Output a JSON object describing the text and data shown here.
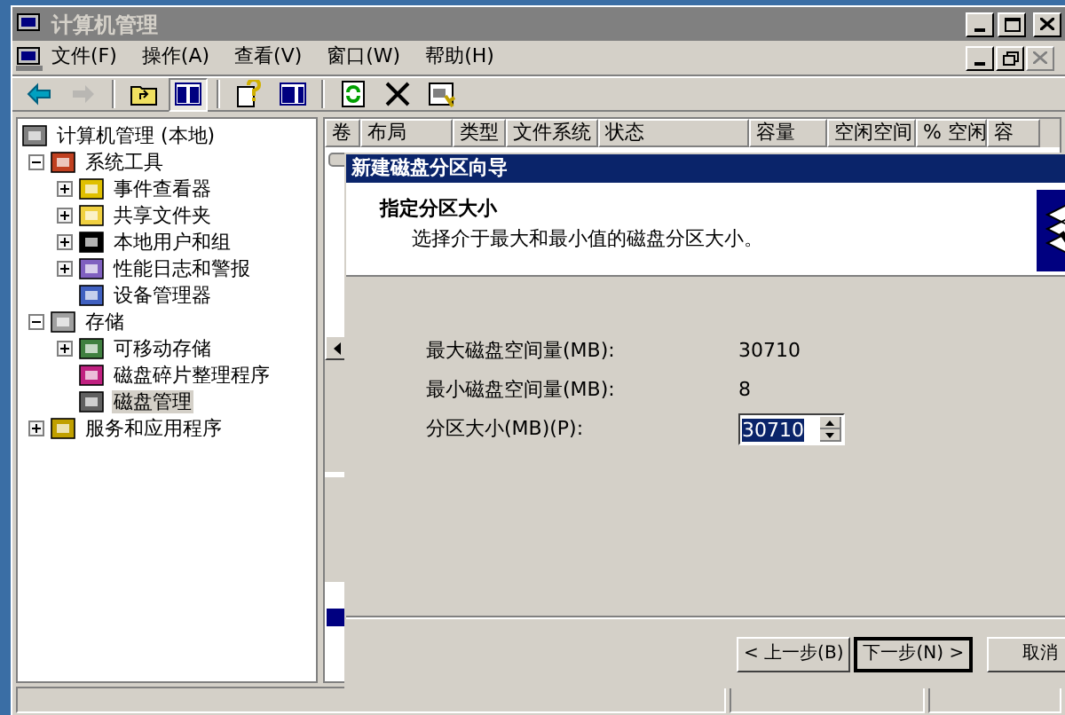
{
  "window": {
    "title": "计算机管理"
  },
  "menu": [
    {
      "label": "文件(F)"
    },
    {
      "label": "操作(A)"
    },
    {
      "label": "查看(V)"
    },
    {
      "label": "窗口(W)"
    },
    {
      "label": "帮助(H)"
    }
  ],
  "toolbar": [
    {
      "kind": "back",
      "disabled": false
    },
    {
      "kind": "forward",
      "disabled": true
    },
    {
      "kind": "sep"
    },
    {
      "kind": "up",
      "disabled": false
    },
    {
      "kind": "tree",
      "disabled": false,
      "selected": true
    },
    {
      "kind": "sep"
    },
    {
      "kind": "help",
      "disabled": false
    },
    {
      "kind": "pane",
      "disabled": false
    },
    {
      "kind": "sep"
    },
    {
      "kind": "refresh",
      "disabled": false
    },
    {
      "kind": "delete",
      "disabled": false
    },
    {
      "kind": "props",
      "disabled": false
    }
  ],
  "tree": [
    {
      "label": "计算机管理 (本地)",
      "selected": false,
      "children": [
        {
          "label": "系统工具",
          "expanded": true,
          "selected": false,
          "children": [
            {
              "label": "事件查看器",
              "expanded": false,
              "selected": false
            },
            {
              "label": "共享文件夹",
              "expanded": false,
              "selected": false
            },
            {
              "label": "本地用户和组",
              "expanded": false,
              "selected": false
            },
            {
              "label": "性能日志和警报",
              "expanded": false,
              "selected": false
            },
            {
              "label": "设备管理器",
              "selected": false
            }
          ]
        },
        {
          "label": "存储",
          "expanded": true,
          "selected": false,
          "children": [
            {
              "label": "可移动存储",
              "expanded": false,
              "selected": false
            },
            {
              "label": "磁盘碎片整理程序",
              "selected": false
            },
            {
              "label": "磁盘管理",
              "selected": true
            }
          ]
        },
        {
          "label": "服务和应用程序",
          "expanded": false,
          "selected": false
        }
      ]
    }
  ],
  "table": {
    "columns": [
      "卷",
      "布局",
      "类型",
      "文件系统",
      "状态",
      "容量",
      "空闲空间",
      "% 空闲",
      "容"
    ]
  },
  "wizard": {
    "title": "新建磁盘分区向导",
    "heading": "指定分区大小",
    "subtitle": "选择介于最大和最小值的磁盘分区大小。",
    "fields": [
      {
        "kind": "readout",
        "label": "最大磁盘空间量(MB):",
        "value": "30710"
      },
      {
        "kind": "readout",
        "label": "最小磁盘空间量(MB):",
        "value": "8"
      },
      {
        "kind": "spin",
        "label": "分区大小(MB)(P):",
        "value": "30710"
      }
    ],
    "buttons": [
      {
        "label": "< 上一步(B)",
        "default": false
      },
      {
        "label": "下一步(N) >",
        "default": true
      },
      {
        "label": "取消",
        "default": false
      }
    ]
  }
}
